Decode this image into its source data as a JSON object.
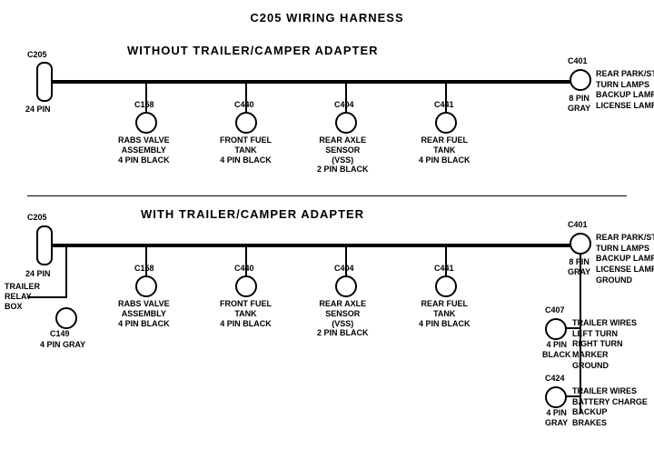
{
  "title": "C205 WIRING HARNESS",
  "section1": {
    "label": "WITHOUT  TRAILER/CAMPER  ADAPTER",
    "connectors": [
      {
        "id": "C205_1",
        "label": "C205",
        "sublabel": "24 PIN"
      },
      {
        "id": "C401_1",
        "label": "C401",
        "sublabel": "8 PIN\nGRAY"
      },
      {
        "id": "C158_1",
        "label": "C158",
        "sublabel": "RABS VALVE\nASSEMBLY\n4 PIN BLACK"
      },
      {
        "id": "C440_1",
        "label": "C440",
        "sublabel": "FRONT FUEL\nTANK\n4 PIN BLACK"
      },
      {
        "id": "C404_1",
        "label": "C404",
        "sublabel": "REAR AXLE\nSENSOR\n(VSS)\n2 PIN BLACK"
      },
      {
        "id": "C441_1",
        "label": "C441",
        "sublabel": "REAR FUEL\nTANK\n4 PIN BLACK"
      }
    ],
    "right_label": "REAR PARK/STOP\nTURN LAMPS\nBACKUP LAMPS\nLICENSE LAMPS"
  },
  "section2": {
    "label": "WITH  TRAILER/CAMPER  ADAPTER",
    "connectors": [
      {
        "id": "C205_2",
        "label": "C205",
        "sublabel": "24 PIN"
      },
      {
        "id": "C401_2",
        "label": "C401",
        "sublabel": "8 PIN\nGRAY"
      },
      {
        "id": "C158_2",
        "label": "C158",
        "sublabel": "RABS VALVE\nASSEMBLY\n4 PIN BLACK"
      },
      {
        "id": "C440_2",
        "label": "C440",
        "sublabel": "FRONT FUEL\nTANK\n4 PIN BLACK"
      },
      {
        "id": "C404_2",
        "label": "C404",
        "sublabel": "REAR AXLE\nSENSOR\n(VSS)\n2 PIN BLACK"
      },
      {
        "id": "C441_2",
        "label": "C441",
        "sublabel": "REAR FUEL\nTANK\n4 PIN BLACK"
      },
      {
        "id": "C149",
        "label": "C149",
        "sublabel": "4 PIN GRAY"
      },
      {
        "id": "C407",
        "label": "C407",
        "sublabel": "4 PIN\nBLACK"
      },
      {
        "id": "C424",
        "label": "C424",
        "sublabel": "4 PIN\nGRAY"
      }
    ],
    "right_label1": "REAR PARK/STOP\nTURN LAMPS\nBACKUP LAMPS\nLICENSE LAMPS\nGROUND",
    "right_label2": "TRAILER WIRES\nLEFT TURN\nRIGHT TURN\nMARKER\nGROUND",
    "right_label3": "TRAILER WIRES\nBATTERY CHARGE\nBACKUP\nBRAKES"
  }
}
